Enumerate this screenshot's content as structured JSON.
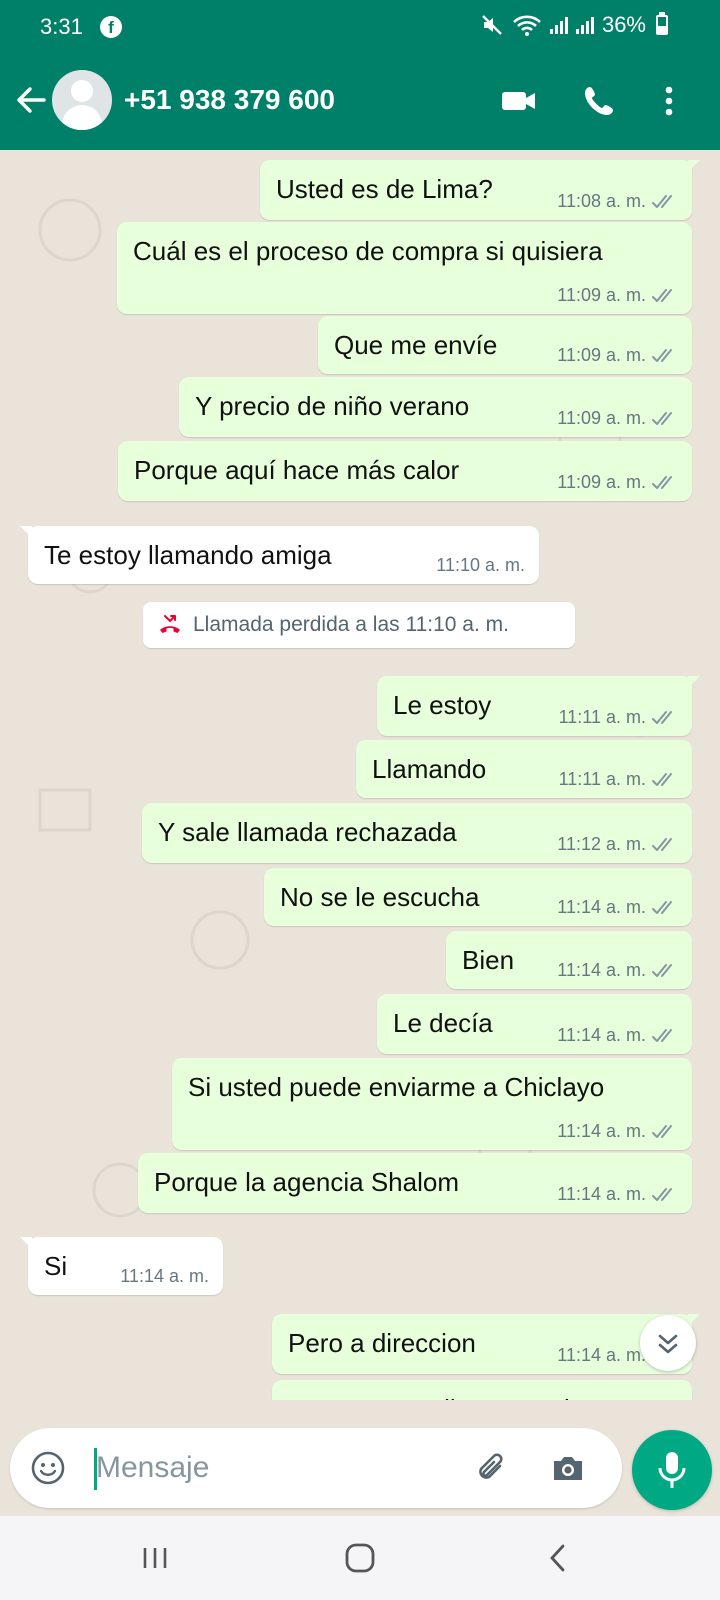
{
  "status": {
    "time": "3:31",
    "battery": "36%",
    "app_icon": "f"
  },
  "header": {
    "contact": "+51 938 379 600"
  },
  "messages": [
    {
      "dir": "out",
      "text": "Usted es de Lima?",
      "time": "11:08 a. m."
    },
    {
      "dir": "out",
      "text": "Cuál es el proceso de compra si quisiera",
      "time": "11:09 a. m."
    },
    {
      "dir": "out",
      "text": "Que me envíe",
      "time": "11:09 a. m."
    },
    {
      "dir": "out",
      "text": "Y precio de niño verano",
      "time": "11:09 a. m."
    },
    {
      "dir": "out",
      "text": "Porque aquí hace más calor",
      "time": "11:09 a. m."
    },
    {
      "dir": "in",
      "text": "Te estoy llamando amiga",
      "time": "11:10 a. m."
    },
    {
      "dir": "out",
      "text": "Le estoy",
      "time": "11:11 a. m."
    },
    {
      "dir": "out",
      "text": "Llamando",
      "time": "11:11 a. m."
    },
    {
      "dir": "out",
      "text": "Y sale llamada rechazada",
      "time": "11:12 a. m."
    },
    {
      "dir": "out",
      "text": "No se le escucha",
      "time": "11:14 a. m."
    },
    {
      "dir": "out",
      "text": "Bien",
      "time": "11:14 a. m."
    },
    {
      "dir": "out",
      "text": "Le decía",
      "time": "11:14 a. m."
    },
    {
      "dir": "out",
      "text": "Si usted puede enviarme a Chiclayo",
      "time": "11:14 a. m."
    },
    {
      "dir": "out",
      "text": "Porque la agencia Shalom",
      "time": "11:14 a. m."
    },
    {
      "dir": "in",
      "text": "Si",
      "time": "11:14 a. m."
    },
    {
      "dir": "out",
      "text": "Pero a direccion",
      "time": "11:14 a. m."
    },
    {
      "dir": "out",
      "text": "Para que me llegue a mi casa",
      "time": ""
    }
  ],
  "missed_call": {
    "text": "Llamada perdida a las 11:10 a. m."
  },
  "composer": {
    "placeholder": "Mensaje"
  },
  "colors": {
    "header": "#008069",
    "outgoing": "#e7ffdb",
    "incoming": "#ffffff",
    "accent": "#00a884",
    "missed": "#ea0038"
  },
  "icons": [
    "back-arrow-icon",
    "video-call-icon",
    "phone-icon",
    "more-vert-icon",
    "missed-call-icon",
    "scroll-down-icon",
    "emoji-icon",
    "attach-icon",
    "camera-icon",
    "mic-icon"
  ]
}
